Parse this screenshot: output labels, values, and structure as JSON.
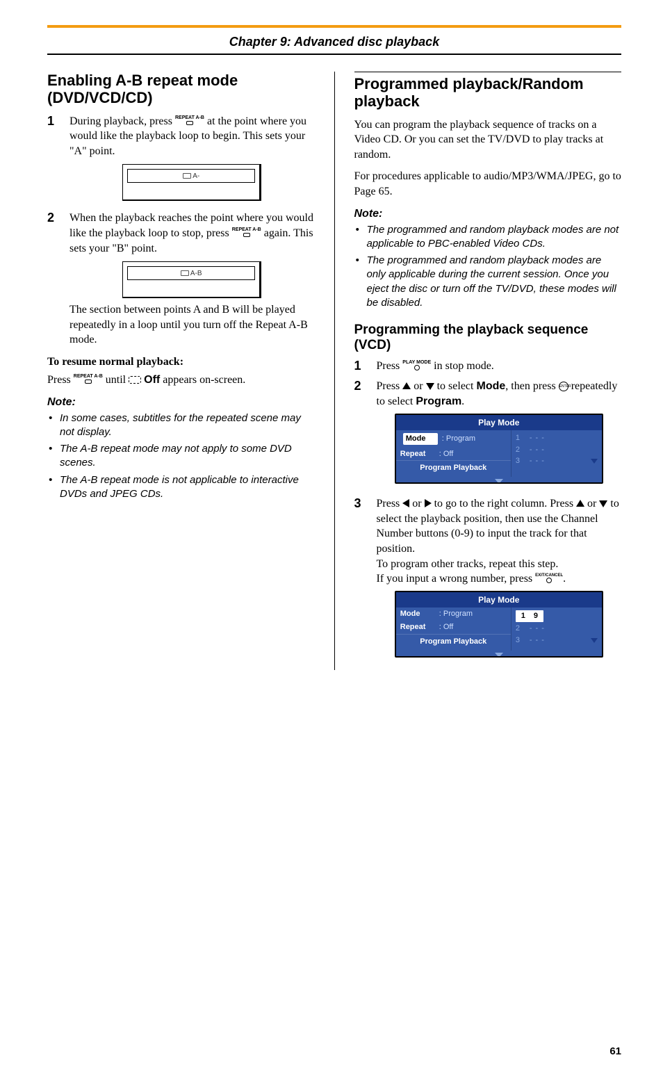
{
  "chapter": "Chapter 9: Advanced disc playback",
  "page_number": "61",
  "left": {
    "h2": "Enabling A-B repeat mode (DVD/VCD/CD)",
    "steps": [
      {
        "num": "1",
        "pre": "During playback, press ",
        "btn": "REPEAT A-B",
        "post": " at the point where you would like the playback loop to begin. This sets your \"A\" point."
      },
      {
        "num": "2",
        "pre": "When the playback reaches the point where you would like the playback loop to stop, press ",
        "btn": "REPEAT A-B",
        "post1": " again. This sets your \"B\" point.",
        "after": "The section between points A and B will be played repeatedly in a loop until you turn off the Repeat A-B mode."
      }
    ],
    "osd1_label": "A-",
    "osd2_label": "A-B",
    "resume_head": "To resume normal playback:",
    "resume_pre": "Press ",
    "resume_btn": "REPEAT A-B",
    "resume_mid": " until ",
    "resume_off": "Off",
    "resume_post": " appears on-screen.",
    "note_head": "Note:",
    "notes": [
      "In some cases, subtitles for the repeated scene may not display.",
      "The A-B repeat mode may not apply to some DVD scenes.",
      "The A-B repeat mode is not applicable to interactive DVDs and JPEG CDs."
    ]
  },
  "right": {
    "h2": "Programmed playback/Random playback",
    "intro1": "You can program the playback sequence of tracks on a Video CD. Or you can set the TV/DVD to play tracks at random.",
    "intro2": "For procedures applicable to audio/MP3/WMA/JPEG, go to Page 65.",
    "note_head": "Note:",
    "notes": [
      "The programmed and random playback modes are not applicable to PBC-enabled Video CDs.",
      "The programmed and random playback modes are only applicable during the current session. Once you eject the disc or turn off the TV/DVD, these modes will be disabled."
    ],
    "h3": "Programming the playback sequence (VCD)",
    "steps": {
      "s1": {
        "num": "1",
        "pre": "Press ",
        "btn": "PLAY MODE",
        "post": " in stop mode."
      },
      "s2": {
        "num": "2",
        "pre": "Press ",
        "mid1": " or ",
        "mid2": " to select ",
        "mode": "Mode",
        "mid3": ", then press ",
        "post": " repeatedly to select ",
        "program": "Program",
        "end": "."
      },
      "s3": {
        "num": "3",
        "pre": "Press ",
        "mid1": " or ",
        "mid2": " to go to the right column. Press ",
        "mid3": " or ",
        "mid4": " to select the playback position, then use the Channel Number buttons (0-9) to input the track for that position.",
        "after1": "To program other tracks, repeat this step.",
        "after2_pre": "If you input a wrong number, press ",
        "after2_btn": "EXIT/CANCEL",
        "after2_post": "."
      }
    },
    "playmode_panel": {
      "title": "Play Mode",
      "mode_label": "Mode",
      "mode_value": ": Program",
      "repeat_label": "Repeat",
      "repeat_value": ": Off",
      "program_playback": "Program Playback",
      "rows_blank": [
        "1",
        "2",
        "3"
      ],
      "blank": "- - -",
      "entered": "9"
    }
  }
}
